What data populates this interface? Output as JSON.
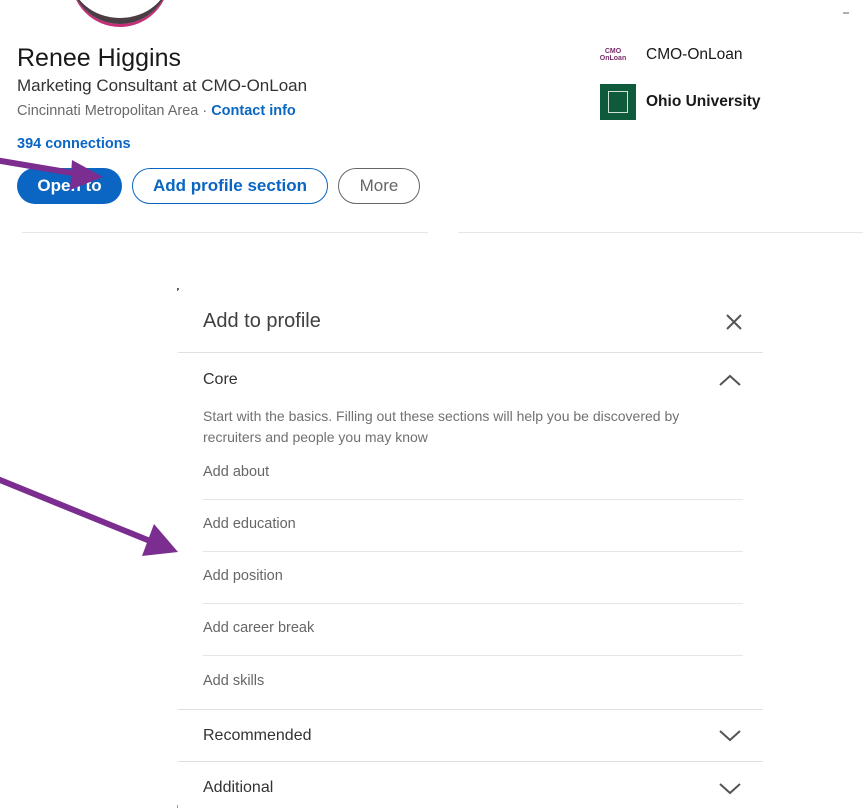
{
  "profile": {
    "name": "Renee Higgins",
    "headline": "Marketing Consultant at CMO-OnLoan",
    "location": "Cincinnati Metropolitan Area",
    "separator": "·",
    "contact_info": "Contact info",
    "connections": "394 connections"
  },
  "actions": {
    "open_to": "Open to",
    "add_profile_section": "Add profile section",
    "more": "More"
  },
  "companies": [
    {
      "name": "CMO-OnLoan",
      "logo_text_top": "CMO",
      "logo_text_bottom": "OnLoan",
      "icon": "cmo-onloan-logo"
    },
    {
      "name": "Ohio University",
      "icon": "ohio-university-logo"
    }
  ],
  "modal": {
    "title": "Add to profile",
    "sections": [
      {
        "title": "Core",
        "expanded": true,
        "description": "Start with the basics. Filling out these sections will help you be discovered by recruiters and people you may know",
        "items": [
          "Add about",
          "Add education",
          "Add position",
          "Add career break",
          "Add skills"
        ]
      },
      {
        "title": "Recommended",
        "expanded": false
      },
      {
        "title": "Additional",
        "expanded": false
      }
    ]
  },
  "colors": {
    "accent": "#0a66c2",
    "annotation_arrow": "#7b2e8f",
    "ohio_green": "#0f5a3a"
  }
}
